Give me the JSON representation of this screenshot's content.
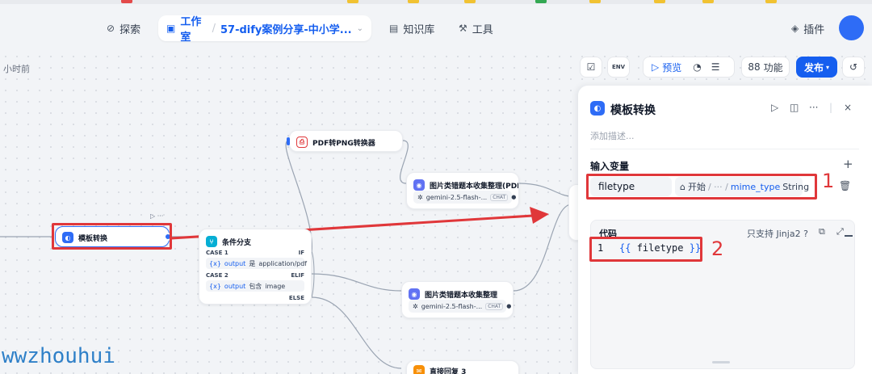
{
  "nav": {
    "explore": "探索",
    "studio": "工作室",
    "app_name": "57-dify案例分享-中小学...",
    "knowledge": "知识库",
    "tools": "工具",
    "plugins": "插件"
  },
  "canvas": {
    "last_edit": "小时前"
  },
  "toolbar": {
    "preview": "预览",
    "features": "功能",
    "publish": "发布",
    "env": "ENV"
  },
  "nodes": {
    "pdf_to_png": "PDF转PNG转换器",
    "llm_pdf": "图片类错题本收集整理(PDF转",
    "llm_img": "图片类错题本收集整理",
    "template": "模板转换",
    "if_else": "条件分支",
    "direct_reply": "直接回复 3",
    "model_name": "gemini-2.5-flash-...",
    "chat_badge": "CHAT",
    "case1": "CASE 1",
    "case2": "CASE 2",
    "if": "IF",
    "elif": "ELIF",
    "else": "ELSE",
    "var_output": "output",
    "cond1_op": "是",
    "cond1_val": "application/pdf",
    "cond2_op": "包含",
    "cond2_val": "image",
    "var_symbol": "{x}"
  },
  "panel": {
    "title": "模板转换",
    "description_placeholder": "添加描述...",
    "inputs_label": "输入变量",
    "var_name": "filetype",
    "var_source": "开始",
    "var_path_sep": "/ ··· /",
    "var_field": "mime_type",
    "var_type": "String",
    "code_label": "代码",
    "jinja_note": "只支持 Jinja2",
    "line_number": "1",
    "code_open": "{{",
    "code_var": "filetype",
    "code_close": "}}"
  },
  "annotations": {
    "label_1": "1",
    "label_2": "2",
    "watermark": "wwzhouhui",
    "accent_red": "#e0373a"
  },
  "colors": {
    "primary": "#155eef",
    "avatar": "#2e6cf6"
  }
}
